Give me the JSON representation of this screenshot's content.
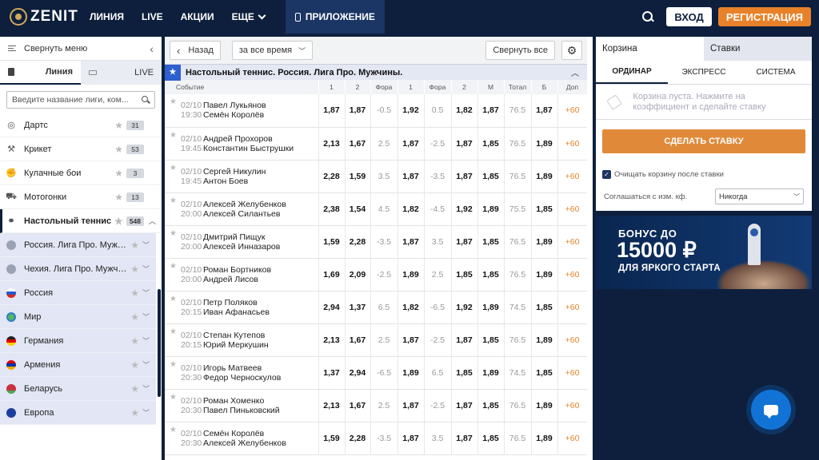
{
  "header": {
    "logo": "ZENIT",
    "nav": [
      "ЛИНИЯ",
      "LIVE",
      "АКЦИИ",
      "ЕЩЕ"
    ],
    "app": "ПРИЛОЖЕНИЕ",
    "login": "ВХОД",
    "register": "РЕГИСТРАЦИЯ"
  },
  "sidebar": {
    "collapse": "Свернуть меню",
    "tabs": [
      "Линия",
      "LIVE"
    ],
    "search_placeholder": "Введите название лиги, ком...",
    "sports": [
      {
        "name": "Дартс",
        "count": "31",
        "icon": "◎"
      },
      {
        "name": "Крикет",
        "count": "53",
        "icon": "⚒"
      },
      {
        "name": "Кулачные бои",
        "count": "3",
        "icon": "✊"
      },
      {
        "name": "Мотогонки",
        "count": "13",
        "icon": "⛟"
      },
      {
        "name": "Настольный теннис",
        "count": "548",
        "icon": "⚭"
      }
    ],
    "leagues": [
      {
        "name": "Россия. Лига Про. Мужчи...",
        "icon": "table-tennis-icon"
      },
      {
        "name": "Чехия. Лига Про. Мужчины",
        "icon": "table-tennis-icon"
      },
      {
        "name": "Россия",
        "icon": "flag-russia"
      },
      {
        "name": "Мир",
        "icon": "globe-icon"
      },
      {
        "name": "Германия",
        "icon": "flag-germany"
      },
      {
        "name": "Армения",
        "icon": "flag-armenia"
      },
      {
        "name": "Беларусь",
        "icon": "flag-belarus"
      },
      {
        "name": "Европа",
        "icon": "flag-europe"
      }
    ]
  },
  "toolbar": {
    "back": "Назад",
    "period": "за все время",
    "collapse_all": "Свернуть все"
  },
  "league": "Настольный теннис. Россия. Лига Про. Мужчины.",
  "columns": [
    "Событие",
    "1",
    "2",
    "Фора",
    "1",
    "Фора",
    "2",
    "М",
    "Тотал",
    "Б",
    "Доп"
  ],
  "events": [
    {
      "date": "02/10",
      "time": "19:30",
      "p1": "Павел Лукьянов",
      "p2": "Семён Королёв",
      "o1": "1,87",
      "o2": "1,87",
      "h1": "-0.5",
      "ho1": "1,92",
      "h2": "0.5",
      "ho2": "1,82",
      "m": "1,87",
      "total": "76.5",
      "b": "1,87",
      "extra": "+60"
    },
    {
      "date": "02/10",
      "time": "19:45",
      "p1": "Андрей Прохоров",
      "p2": "Константин Быструшки",
      "o1": "2,13",
      "o2": "1,67",
      "h1": "2.5",
      "ho1": "1,87",
      "h2": "-2.5",
      "ho2": "1,87",
      "m": "1,85",
      "total": "76.5",
      "b": "1,89",
      "extra": "+60"
    },
    {
      "date": "02/10",
      "time": "19:45",
      "p1": "Сергей Никулин",
      "p2": "Антон Боев",
      "o1": "2,28",
      "o2": "1,59",
      "h1": "3.5",
      "ho1": "1,87",
      "h2": "-3.5",
      "ho2": "1,87",
      "m": "1,85",
      "total": "76.5",
      "b": "1,89",
      "extra": "+60"
    },
    {
      "date": "02/10",
      "time": "20:00",
      "p1": "Алексей Желубенков",
      "p2": "Алексей Силантьев",
      "o1": "2,38",
      "o2": "1,54",
      "h1": "4.5",
      "ho1": "1,82",
      "h2": "-4.5",
      "ho2": "1,92",
      "m": "1,89",
      "total": "75.5",
      "b": "1,85",
      "extra": "+60"
    },
    {
      "date": "02/10",
      "time": "20:00",
      "p1": "Дмитрий Пищук",
      "p2": "Алексей Инназаров",
      "o1": "1,59",
      "o2": "2,28",
      "h1": "-3.5",
      "ho1": "1,87",
      "h2": "3.5",
      "ho2": "1,87",
      "m": "1,85",
      "total": "76.5",
      "b": "1,89",
      "extra": "+60"
    },
    {
      "date": "02/10",
      "time": "20:00",
      "p1": "Роман Бортников",
      "p2": "Андрей Лисов",
      "o1": "1,69",
      "o2": "2,09",
      "h1": "-2.5",
      "ho1": "1,89",
      "h2": "2.5",
      "ho2": "1,85",
      "m": "1,85",
      "total": "76.5",
      "b": "1,89",
      "extra": "+60"
    },
    {
      "date": "02/10",
      "time": "20:15",
      "p1": "Петр Поляков",
      "p2": "Иван Афанасьев",
      "o1": "2,94",
      "o2": "1,37",
      "h1": "6.5",
      "ho1": "1,82",
      "h2": "-6.5",
      "ho2": "1,92",
      "m": "1,89",
      "total": "74.5",
      "b": "1,85",
      "extra": "+60"
    },
    {
      "date": "02/10",
      "time": "20:15",
      "p1": "Степан Кутепов",
      "p2": "Юрий Меркушин",
      "o1": "2,13",
      "o2": "1,67",
      "h1": "2.5",
      "ho1": "1,87",
      "h2": "-2.5",
      "ho2": "1,87",
      "m": "1,85",
      "total": "76.5",
      "b": "1,89",
      "extra": "+60"
    },
    {
      "date": "02/10",
      "time": "20:30",
      "p1": "Игорь Матвеев",
      "p2": "Федор Черноскулов",
      "o1": "1,37",
      "o2": "2,94",
      "h1": "-6.5",
      "ho1": "1,89",
      "h2": "6.5",
      "ho2": "1,85",
      "m": "1,89",
      "total": "74.5",
      "b": "1,85",
      "extra": "+60"
    },
    {
      "date": "02/10",
      "time": "20:30",
      "p1": "Роман Хоменко",
      "p2": "Павел Пиньковский",
      "o1": "2,13",
      "o2": "1,67",
      "h1": "2.5",
      "ho1": "1,87",
      "h2": "-2.5",
      "ho2": "1,87",
      "m": "1,85",
      "total": "76.5",
      "b": "1,89",
      "extra": "+60"
    },
    {
      "date": "02/10",
      "time": "20:30",
      "p1": "Семён Королёв",
      "p2": "Алексей Желубенков",
      "o1": "1,59",
      "o2": "2,28",
      "h1": "-3.5",
      "ho1": "1,87",
      "h2": "3.5",
      "ho2": "1,87",
      "m": "1,85",
      "total": "76.5",
      "b": "1,89",
      "extra": "+60"
    }
  ],
  "betslip": {
    "tabs": [
      "Корзина",
      "Ставки"
    ],
    "subtabs": [
      "ОРДИНАР",
      "ЭКСПРЕСС",
      "СИСТЕМА"
    ],
    "empty": "Корзина пуста. Нажмите на коэффициент и сделайте ставку",
    "make_bet": "СДЕЛАТЬ СТАВКУ",
    "clear_label": "Очищать корзину после ставки",
    "agree_label": "Соглашаться с изм. кф.",
    "agree_value": "Никогда"
  },
  "banner": {
    "line1": "БОНУС ДО",
    "line2": "15000 ₽",
    "line3": "ДЛЯ ЯРКОГО СТАРТА"
  },
  "colors": {
    "navy": "#0d1f3c",
    "orange": "#e8822a",
    "league_bg": "#e3e6f4"
  }
}
